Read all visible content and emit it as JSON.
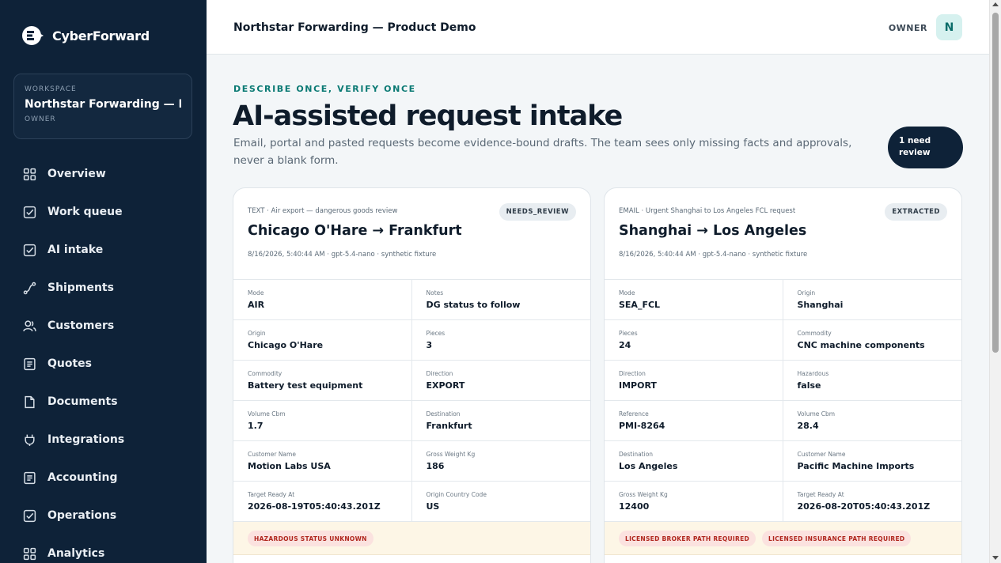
{
  "brand": {
    "name": "CyberForward"
  },
  "workspace": {
    "label": "WORKSPACE",
    "name": "Northstar Forwarding — P...",
    "role": "OWNER"
  },
  "nav": [
    {
      "label": "Overview",
      "icon": "grid-icon"
    },
    {
      "label": "Work queue",
      "icon": "checkbox-icon"
    },
    {
      "label": "AI intake",
      "icon": "checkbox-icon"
    },
    {
      "label": "Shipments",
      "icon": "route-icon"
    },
    {
      "label": "Customers",
      "icon": "users-icon"
    },
    {
      "label": "Quotes",
      "icon": "list-doc-icon"
    },
    {
      "label": "Documents",
      "icon": "file-icon"
    },
    {
      "label": "Integrations",
      "icon": "plug-icon"
    },
    {
      "label": "Accounting",
      "icon": "list-doc-icon"
    },
    {
      "label": "Operations",
      "icon": "checkbox-icon"
    },
    {
      "label": "Analytics",
      "icon": "grid-icon"
    }
  ],
  "header": {
    "title": "Northstar Forwarding — Product Demo",
    "role": "OWNER",
    "avatar": "N"
  },
  "page": {
    "eyebrow": "DESCRIBE ONCE, VERIFY ONCE",
    "title": "AI-assisted request intake",
    "subtitle": "Email, portal and pasted requests become evidence-bound drafts. The team sees only missing facts and approvals, never a blank form.",
    "review_pill": "1 need review"
  },
  "cards": [
    {
      "source": "TEXT · Air export — dangerous goods review",
      "status": "NEEDS_REVIEW",
      "route": "Chicago O'Hare → Frankfurt",
      "meta": "8/16/2026, 5:40:44 AM · gpt-5.4-nano · synthetic fixture",
      "fields": [
        {
          "label": "Mode",
          "value": "AIR"
        },
        {
          "label": "Notes",
          "value": "DG status to follow"
        },
        {
          "label": "Origin",
          "value": "Chicago O'Hare"
        },
        {
          "label": "Pieces",
          "value": "3"
        },
        {
          "label": "Commodity",
          "value": "Battery test equipment"
        },
        {
          "label": "Direction",
          "value": "EXPORT"
        },
        {
          "label": "Volume Cbm",
          "value": "1.7"
        },
        {
          "label": "Destination",
          "value": "Frankfurt"
        },
        {
          "label": "Customer Name",
          "value": "Motion Labs USA"
        },
        {
          "label": "Gross Weight Kg",
          "value": "186"
        },
        {
          "label": "Target Ready At",
          "value": "2026-08-19T05:40:43.201Z"
        },
        {
          "label": "Origin Country Code",
          "value": "US"
        }
      ],
      "warnings": [
        "HAZARDOUS STATUS UNKNOWN"
      ]
    },
    {
      "source": "EMAIL · Urgent Shanghai to Los Angeles FCL request",
      "status": "EXTRACTED",
      "route": "Shanghai → Los Angeles",
      "meta": "8/16/2026, 5:40:44 AM · gpt-5.4-nano · synthetic fixture",
      "fields": [
        {
          "label": "Mode",
          "value": "SEA_FCL"
        },
        {
          "label": "Origin",
          "value": "Shanghai"
        },
        {
          "label": "Pieces",
          "value": "24"
        },
        {
          "label": "Commodity",
          "value": "CNC machine components"
        },
        {
          "label": "Direction",
          "value": "IMPORT"
        },
        {
          "label": "Hazardous",
          "value": "false"
        },
        {
          "label": "Reference",
          "value": "PMI-8264"
        },
        {
          "label": "Volume Cbm",
          "value": "28.4"
        },
        {
          "label": "Destination",
          "value": "Los Angeles"
        },
        {
          "label": "Customer Name",
          "value": "Pacific Machine Imports"
        },
        {
          "label": "Gross Weight Kg",
          "value": "12400"
        },
        {
          "label": "Target Ready At",
          "value": "2026-08-20T05:40:43.201Z"
        }
      ],
      "warnings": [
        "LICENSED BROKER PATH REQUIRED",
        "LICENSED INSURANCE PATH REQUIRED"
      ]
    }
  ]
}
